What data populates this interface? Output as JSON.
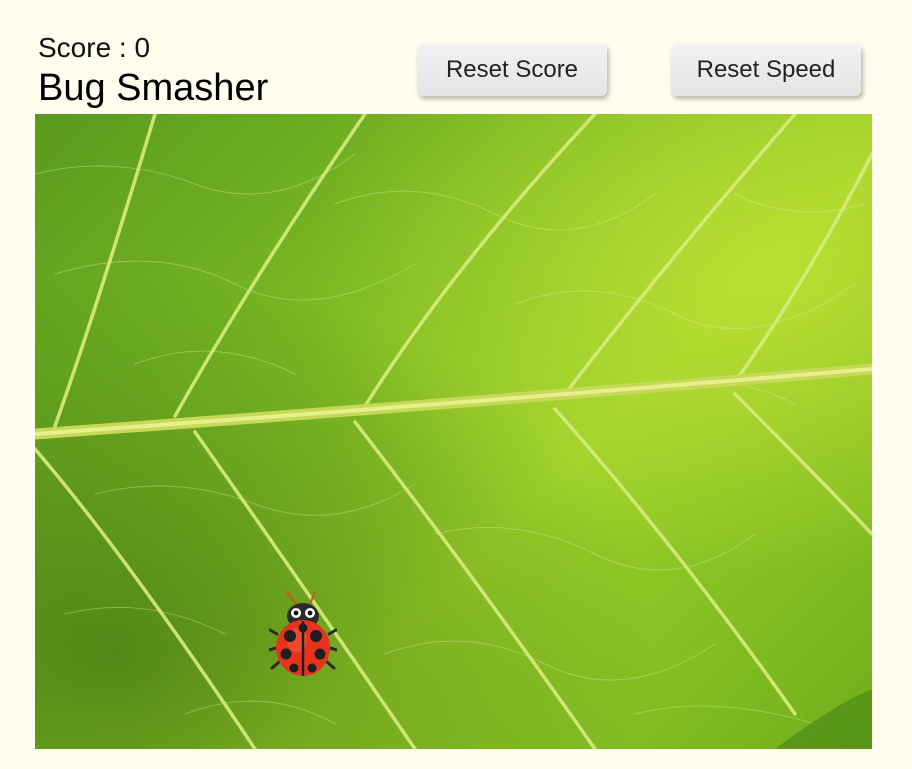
{
  "header": {
    "score_label": "Score : 0",
    "title": "Bug Smasher"
  },
  "buttons": {
    "reset_score": "Reset Score",
    "reset_speed": "Reset Speed"
  },
  "game": {
    "background": "green-leaf-texture",
    "bug_icon": "ladybug-icon",
    "colors": {
      "page_background": "#fefdee",
      "leaf_green": "#7dbb24",
      "ladybug_red": "#e8321e"
    }
  }
}
